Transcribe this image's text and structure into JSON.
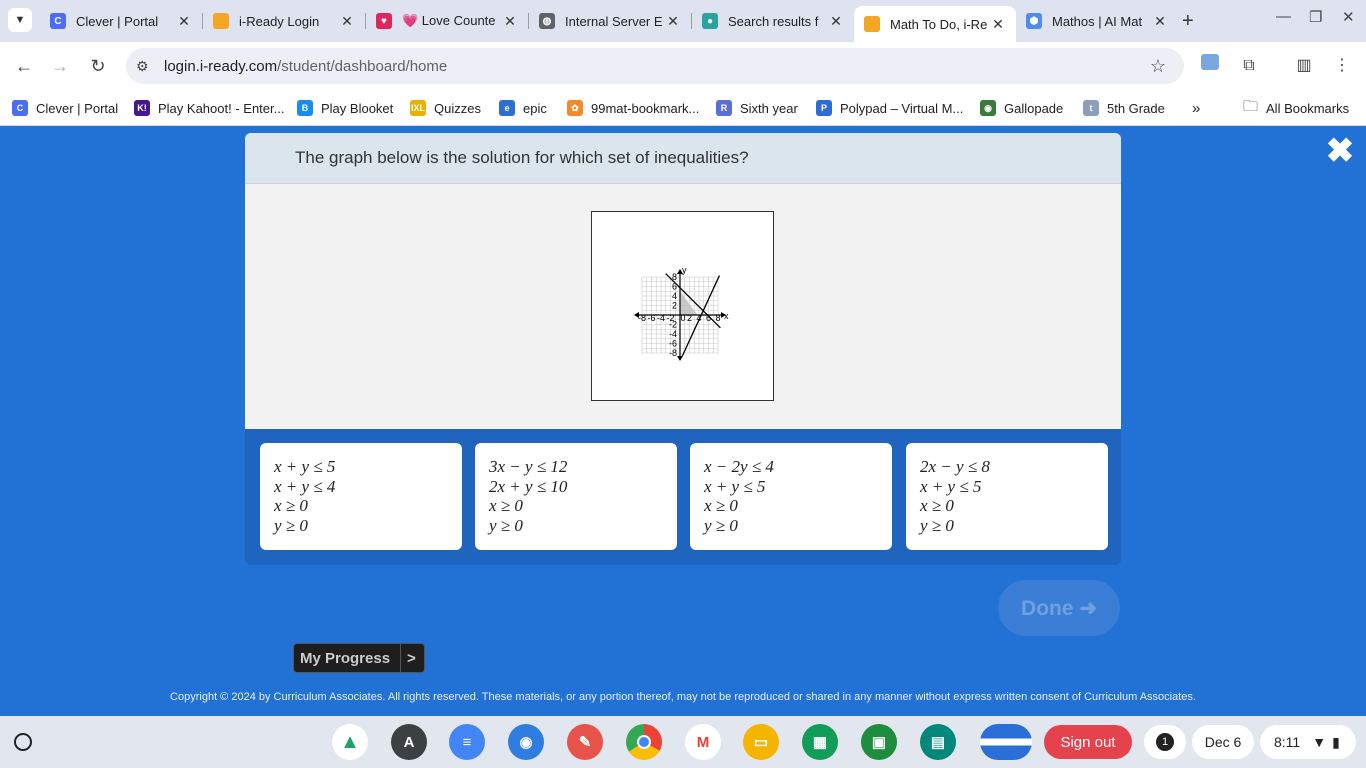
{
  "browser": {
    "tabs": [
      {
        "title": "Clever | Portal",
        "favicon": "clever-icon",
        "color": "#4a6cf7",
        "glyph": "C"
      },
      {
        "title": "i-Ready Login",
        "favicon": "iready-cube-icon",
        "color": "#f5a623",
        "glyph": ""
      },
      {
        "title": "💗 Love Counte",
        "favicon": "heart-icon",
        "color": "#e0245e",
        "glyph": "♥"
      },
      {
        "title": "Internal Server E",
        "favicon": "globe-icon",
        "color": "#5f6368",
        "glyph": "◍"
      },
      {
        "title": "Search results f",
        "favicon": "dot-icon",
        "color": "#2aa3a0",
        "glyph": "●"
      },
      {
        "title": "Math To Do, i-Re",
        "favicon": "iready-cube-icon",
        "color": "#f5a623",
        "glyph": ""
      },
      {
        "title": "Mathos | AI Mat",
        "favicon": "mathos-icon",
        "color": "#4e8cf0",
        "glyph": "⬢"
      }
    ],
    "active_tab_index": 5,
    "url_domain": "login.i-ready.com",
    "url_path": "/student/dashboard/home",
    "bookmarks": [
      {
        "label": "Clever | Portal",
        "color": "#4a6cf7",
        "glyph": "C"
      },
      {
        "label": "Play Kahoot! - Enter...",
        "color": "#46178f",
        "glyph": "K!"
      },
      {
        "label": "Play Blooket",
        "color": "#1a8cf0",
        "glyph": "B"
      },
      {
        "label": "Quizzes",
        "color": "#e8b100",
        "glyph": "IXL"
      },
      {
        "label": "epic",
        "color": "#2b6fd1",
        "glyph": "e"
      },
      {
        "label": "99mat-bookmark...",
        "color": "#f28a28",
        "glyph": "✿"
      },
      {
        "label": "Sixth year",
        "color": "#5b6fd8",
        "glyph": "R"
      },
      {
        "label": "Polypad – Virtual M...",
        "color": "#2d6bd6",
        "glyph": "P"
      },
      {
        "label": "Gallopade",
        "color": "#3a7a3a",
        "glyph": "◉"
      },
      {
        "label": "5th Grade",
        "color": "#8aa0b8",
        "glyph": "t"
      }
    ],
    "all_bookmarks_label": "All Bookmarks"
  },
  "question": {
    "prompt": "The graph below is the solution for which set of inequalities?"
  },
  "graph": {
    "x_tick_labels": [
      "-8",
      "-6",
      "-4",
      "-2",
      "0",
      "2",
      "4",
      "6",
      "8"
    ],
    "y_tick_labels": [
      "8",
      "6",
      "4",
      "2",
      "-2",
      "-4",
      "-6",
      "-8"
    ],
    "x_axis_label": "x",
    "y_axis_label": "y",
    "xlim": [
      -8,
      8
    ],
    "ylim": [
      -8,
      8
    ],
    "line_a": {
      "x1": -3,
      "y1": 8.7,
      "x2": 8.5,
      "y2": -2.7
    },
    "line_b": {
      "x1": 0.5,
      "y1": -8.6,
      "x2": 8.3,
      "y2": 8.3
    },
    "shaded_region": [
      [
        0,
        0
      ],
      [
        0,
        5
      ],
      [
        3.7,
        0
      ]
    ]
  },
  "answers": [
    {
      "lines": [
        "x + y ≤ 5",
        "x + y ≤ 4",
        "x ≥ 0",
        "y ≥ 0"
      ]
    },
    {
      "lines": [
        "3x − y ≤ 12",
        "2x + y ≤ 10",
        "x ≥ 0",
        "y ≥ 0"
      ]
    },
    {
      "lines": [
        "x − 2y ≤ 4",
        "x + y ≤ 5",
        "x ≥ 0",
        "y ≥ 0"
      ]
    },
    {
      "lines": [
        "2x − y ≤ 8",
        "x + y ≤ 5",
        "x ≥ 0",
        "y ≥ 0"
      ]
    }
  ],
  "done_label": "Done ➜",
  "progress_label": "My Progress",
  "progress_arrow": ">",
  "copyright": "Copyright © 2024 by Curriculum Associates. All rights reserved. These materials, or any portion thereof, may not be reproduced or shared in any manner without express written consent of Curriculum Associates.",
  "shelf": {
    "sign_out_label": "Sign out",
    "notification_count": "1",
    "date": "Dec 6",
    "time": "8:11"
  }
}
